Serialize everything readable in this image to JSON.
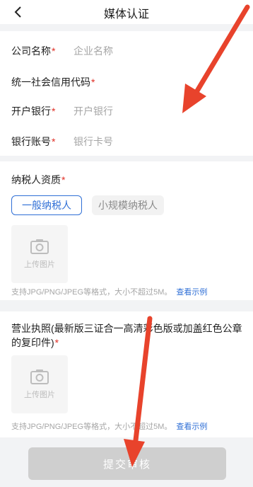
{
  "header": {
    "title": "媒体认证"
  },
  "form": {
    "company_name": {
      "label": "公司名称",
      "placeholder": "企业名称"
    },
    "credit_code": {
      "label": "统一社会信用代码"
    },
    "bank": {
      "label": "开户银行",
      "placeholder": "开户银行"
    },
    "account": {
      "label": "银行账号",
      "placeholder": "银行卡号"
    },
    "required_mark": "*"
  },
  "taxpayer": {
    "label": "纳税人资质",
    "options": [
      {
        "label": "一般纳税人",
        "selected": true
      },
      {
        "label": "小规模纳税人",
        "selected": false
      }
    ],
    "upload_label": "上传图片",
    "hint": "支持JPG/PNG/JPEG等格式，大小不超过5M。",
    "hint_link": "查看示例"
  },
  "license": {
    "label": "营业执照(最新版三证合一高清彩色版或加盖红色公章的复印件)",
    "upload_label": "上传图片",
    "hint": "支持JPG/PNG/JPEG等格式，大小不超过5M。",
    "hint_link": "查看示例"
  },
  "submit_label": "提交审核",
  "colors": {
    "accent": "#2f6fd6",
    "required": "#e02e24",
    "annotation_arrow": "#e8432c",
    "submit_disabled": "#cfcfcf"
  },
  "icons": [
    "back-arrow-icon",
    "camera-icon"
  ]
}
